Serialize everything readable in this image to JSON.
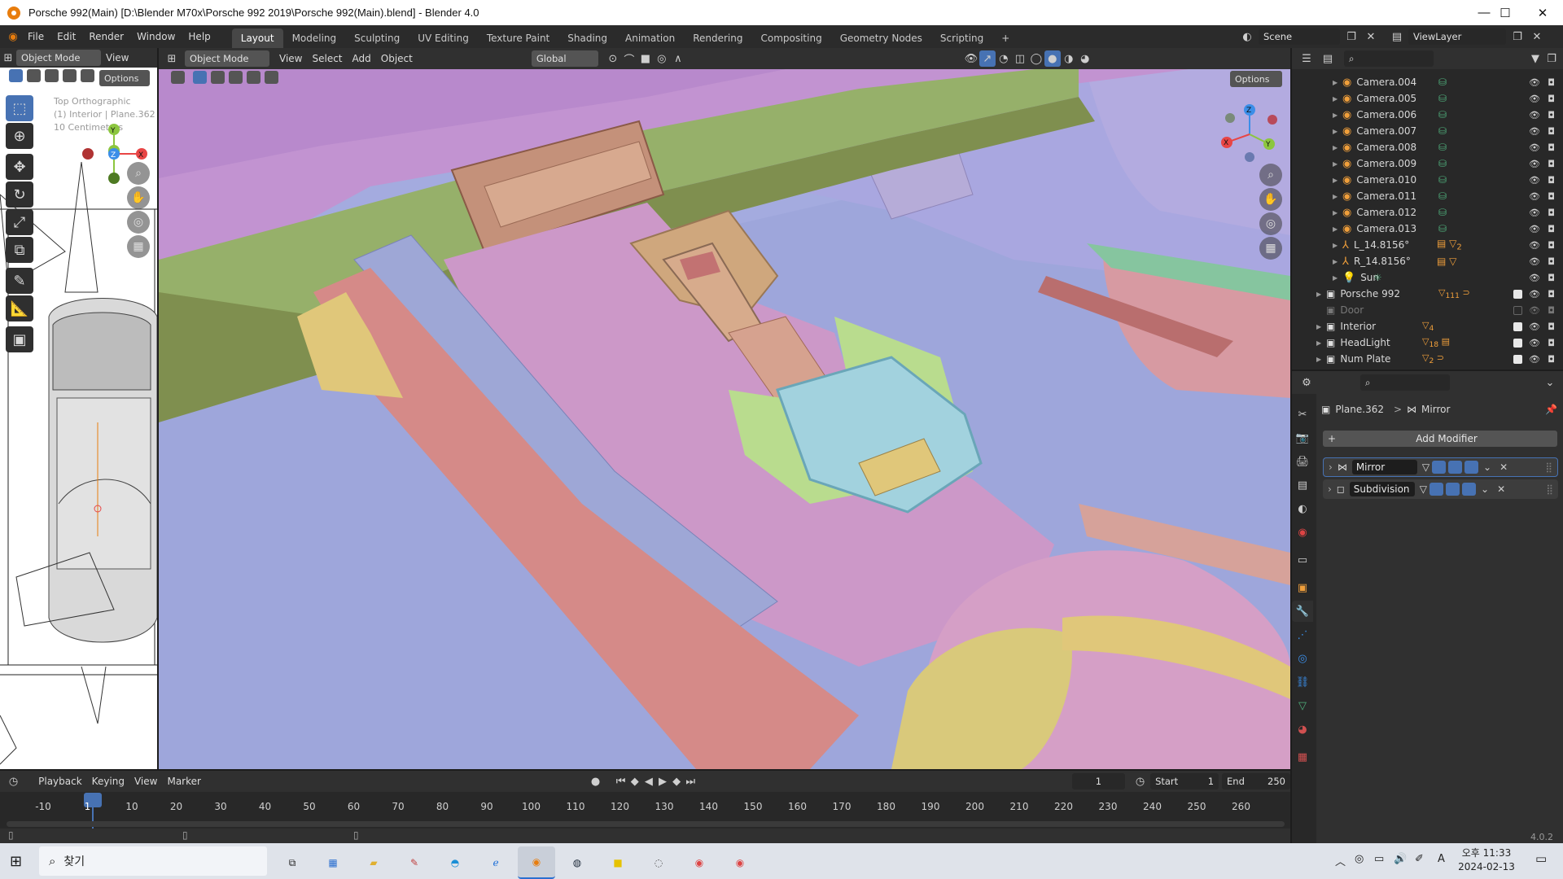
{
  "window": {
    "title": "Porsche 992(Main) [D:\\Blender M70x\\Porsche 992 2019\\Porsche 992(Main).blend] - Blender 4.0",
    "minimize": "—",
    "maximize": "☐",
    "close": "✕"
  },
  "menu": {
    "items": [
      "File",
      "Edit",
      "Render",
      "Window",
      "Help"
    ],
    "workspaces": [
      "Layout",
      "Modeling",
      "Sculpting",
      "UV Editing",
      "Texture Paint",
      "Shading",
      "Animation",
      "Rendering",
      "Compositing",
      "Geometry Nodes",
      "Scripting"
    ],
    "add_tab": "+",
    "scene_label": "Scene",
    "viewlayer_label": "ViewLayer"
  },
  "left_view": {
    "mode": "Object Mode",
    "view_cut": "View",
    "options": "Options",
    "overlay_line1": "Top Orthographic",
    "overlay_line2": "(1) Interior | Plane.362",
    "overlay_line3": "10 Centimeters"
  },
  "main_view": {
    "mode": "Object Mode",
    "menus": [
      "View",
      "Select",
      "Add",
      "Object"
    ],
    "transform": "Global",
    "options": "Options",
    "gizmo": {
      "x": "X",
      "y": "Y",
      "z": "Z"
    }
  },
  "outliner": {
    "rows": [
      {
        "name": "Camera.004",
        "type": "camera"
      },
      {
        "name": "Camera.005",
        "type": "camera"
      },
      {
        "name": "Camera.006",
        "type": "camera"
      },
      {
        "name": "Camera.007",
        "type": "camera"
      },
      {
        "name": "Camera.008",
        "type": "camera"
      },
      {
        "name": "Camera.009",
        "type": "camera"
      },
      {
        "name": "Camera.010",
        "type": "camera"
      },
      {
        "name": "Camera.011",
        "type": "camera"
      },
      {
        "name": "Camera.012",
        "type": "camera"
      },
      {
        "name": "Camera.013",
        "type": "camera"
      },
      {
        "name": "L_14.8156°",
        "type": "empty",
        "badge": "2"
      },
      {
        "name": "R_14.8156°",
        "type": "empty"
      },
      {
        "name": "Sun",
        "type": "light"
      }
    ],
    "collections": [
      {
        "name": "Porsche 992",
        "checked": true,
        "badge": "111"
      },
      {
        "name": "Door",
        "checked": false,
        "badge": ""
      },
      {
        "name": "Interior",
        "checked": true,
        "badge": "4"
      },
      {
        "name": "HeadLight",
        "checked": true,
        "badge": "18"
      },
      {
        "name": "Num Plate",
        "checked": true,
        "badge": "2"
      }
    ]
  },
  "properties": {
    "breadcrumb_object": "Plane.362",
    "breadcrumb_sep": ">",
    "breadcrumb_modifier": "Mirror",
    "add_modifier": "Add Modifier",
    "modifiers": [
      {
        "name": "Mirror"
      },
      {
        "name": "Subdivision"
      }
    ]
  },
  "timeline": {
    "menus": [
      "Playback",
      "Keying",
      "View",
      "Marker"
    ],
    "current_frame": "1",
    "start_label": "Start",
    "start": "1",
    "end_label": "End",
    "end": "250",
    "ticks": [
      "-10",
      "1",
      "10",
      "20",
      "30",
      "40",
      "50",
      "60",
      "70",
      "80",
      "90",
      "100",
      "110",
      "120",
      "130",
      "140",
      "150",
      "160",
      "170",
      "180",
      "190",
      "200",
      "210",
      "220",
      "230",
      "240",
      "250",
      "260"
    ],
    "version": "4.0.2"
  },
  "taskbar": {
    "search": "찾기",
    "time": "오후 11:33",
    "date": "2024-02-13",
    "ime": "A"
  },
  "colors": {
    "accent_blue": "#4772b3",
    "blender_orange": "#e87d0d",
    "axis_x": "#e84545",
    "axis_y": "#8cc63f",
    "axis_z": "#3b8ee8"
  }
}
